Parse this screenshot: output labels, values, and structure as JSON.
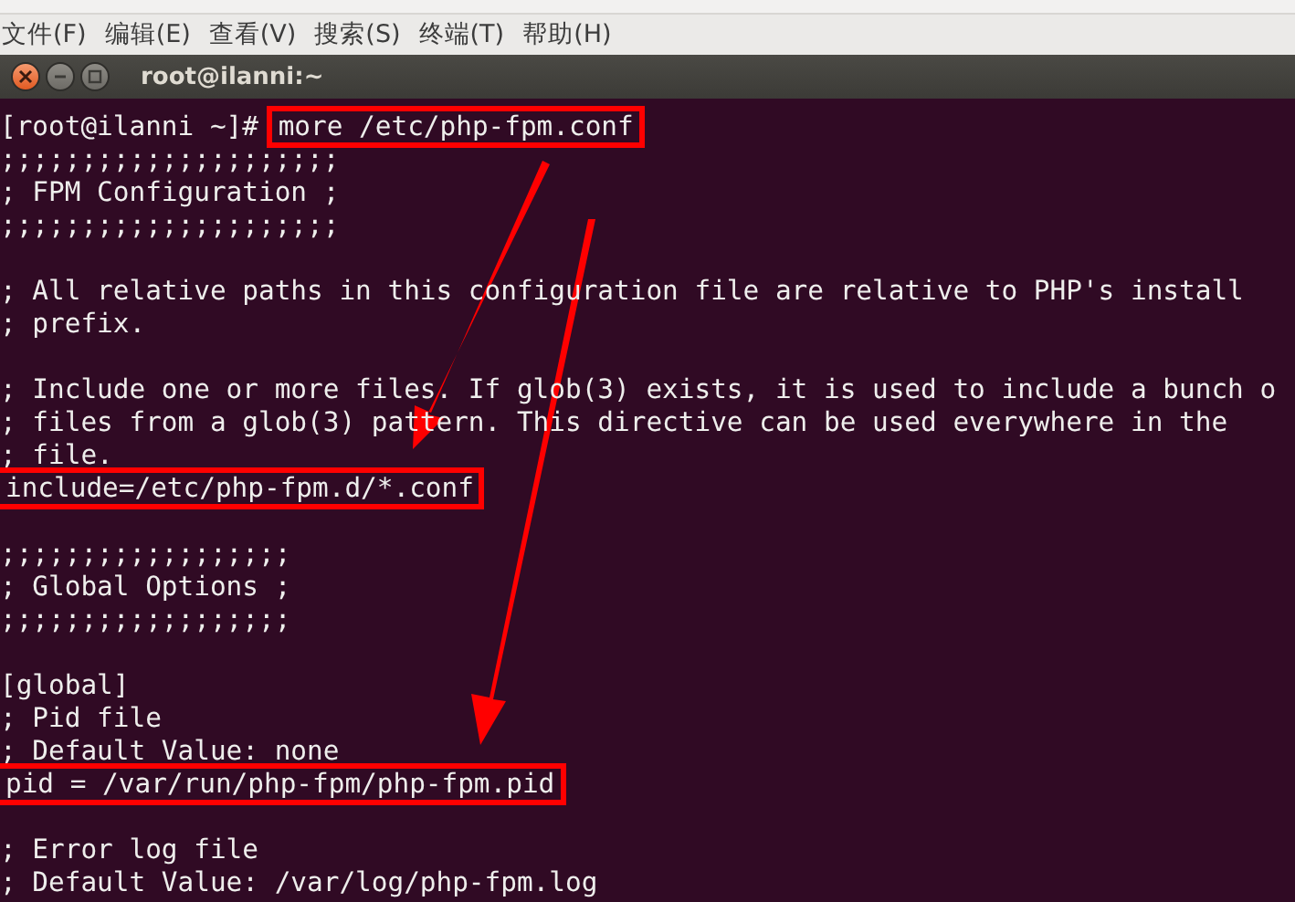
{
  "menu": [
    "文件(F)",
    "编辑(E)",
    "查看(V)",
    "搜索(S)",
    "终端(T)",
    "帮助(H)"
  ],
  "window": {
    "title": "root@ilanni:~"
  },
  "terminal": {
    "prompt": "[root@ilanni ~]#",
    "command": "more /etc/php-fpm.conf",
    "command_highlighted": true,
    "lines": [
      {
        "kind": "text",
        "text": ";;;;;;;;;;;;;;;;;;;;;",
        "highlighted": false
      },
      {
        "kind": "text",
        "text": "; FPM Configuration ;",
        "highlighted": false
      },
      {
        "kind": "text",
        "text": ";;;;;;;;;;;;;;;;;;;;;",
        "highlighted": false
      },
      {
        "kind": "blank"
      },
      {
        "kind": "text",
        "text": "; All relative paths in this configuration file are relative to PHP's install",
        "highlighted": false
      },
      {
        "kind": "text",
        "text": "; prefix.",
        "highlighted": false
      },
      {
        "kind": "blank"
      },
      {
        "kind": "text",
        "text": "; Include one or more files. If glob(3) exists, it is used to include a bunch o",
        "highlighted": false
      },
      {
        "kind": "text",
        "text": "; files from a glob(3) pattern. This directive can be used everywhere in the",
        "highlighted": false
      },
      {
        "kind": "text",
        "text": "; file.",
        "highlighted": false
      },
      {
        "kind": "text",
        "text": "include=/etc/php-fpm.d/*.conf",
        "highlighted": true
      },
      {
        "kind": "blank"
      },
      {
        "kind": "text",
        "text": ";;;;;;;;;;;;;;;;;;",
        "highlighted": false
      },
      {
        "kind": "text",
        "text": "; Global Options ;",
        "highlighted": false
      },
      {
        "kind": "text",
        "text": ";;;;;;;;;;;;;;;;;;",
        "highlighted": false
      },
      {
        "kind": "blank"
      },
      {
        "kind": "text",
        "text": "[global]",
        "highlighted": false
      },
      {
        "kind": "text",
        "text": "; Pid file",
        "highlighted": false
      },
      {
        "kind": "text",
        "text": "; Default Value: none",
        "highlighted": false
      },
      {
        "kind": "text",
        "text": "pid = /var/run/php-fpm/php-fpm.pid",
        "highlighted": true
      },
      {
        "kind": "blank"
      },
      {
        "kind": "text",
        "text": "; Error log file",
        "highlighted": false
      },
      {
        "kind": "text",
        "text": "; Default Value: /var/log/php-fpm.log",
        "highlighted": false
      }
    ]
  }
}
